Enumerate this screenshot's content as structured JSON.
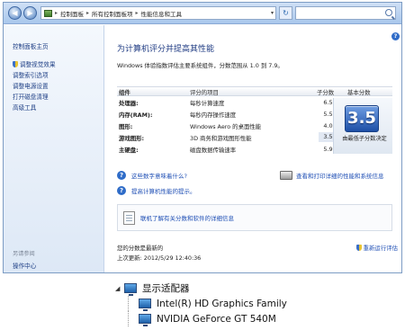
{
  "window": {
    "breadcrumbs": [
      "控制面板",
      "所有控制面板项",
      "性能信息和工具"
    ],
    "sidebar": {
      "home": "控制面板主页",
      "items": [
        "调整视觉效果",
        "调整索引选项",
        "调整电源设置",
        "打开磁盘清理",
        "高级工具"
      ],
      "see_also": "另请参阅",
      "action_center": "操作中心"
    },
    "main": {
      "title": "为计算机评分并提高其性能",
      "description": "Windows 体验指数评估主要系统组件，分数范围从 1.0 到 7.9。",
      "table": {
        "headers": [
          "组件",
          "评分的项目",
          "子分数",
          "基本分数"
        ],
        "rows": [
          {
            "component": "处理器:",
            "item": "每秒计算速度",
            "score": "6.5"
          },
          {
            "component": "内存(RAM):",
            "item": "每秒内存操作速度",
            "score": "5.5"
          },
          {
            "component": "图形:",
            "item": "Windows Aero 的桌面性能",
            "score": "4.0"
          },
          {
            "component": "游戏图形:",
            "item": "3D 商务和游戏图形性能",
            "score": "3.5"
          },
          {
            "component": "主硬盘:",
            "item": "磁盘数据传输速率",
            "score": "5.9"
          }
        ],
        "base_score": "3.5",
        "base_caption": "由最低子分数决定"
      },
      "links": {
        "what_mean": "这些数字意味着什么?",
        "improve": "提高计算机性能的提示。",
        "print": "查看和打印详细的性能和系统信息",
        "learn": "联机了解有关分数和软件的详细信息"
      },
      "score_valid": "您的分数是最新的",
      "last_update": "上次更新: 2012/5/29 12:40:36",
      "rerun": "重新运行评估"
    }
  },
  "device_tree": {
    "category": "显示适配器",
    "devices": [
      "Intel(R) HD Graphics Family",
      "NVIDIA GeForce GT 540M"
    ]
  }
}
